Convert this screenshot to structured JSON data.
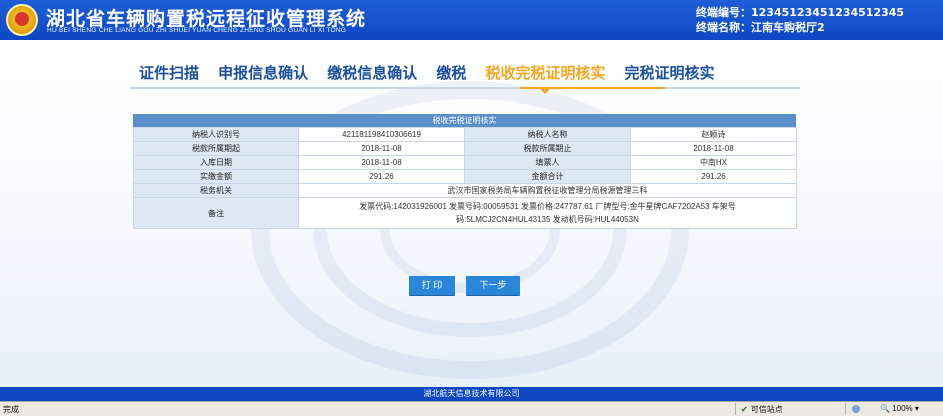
{
  "header": {
    "title_cn": "湖北省车辆购置税远程征收管理系统",
    "title_en": "HU BEI SHENG CHE LIANG GOU ZHI SHUEI YUAN CHENG ZHENG SHOU GUAN LI XI TONG",
    "terminal_no": "终端编号：12345123451234512345",
    "terminal_name": "终端名称：江南车购税厅2"
  },
  "steps": [
    {
      "label": "证件扫描",
      "active": false
    },
    {
      "label": "申报信息确认",
      "active": false
    },
    {
      "label": "缴税信息确认",
      "active": false
    },
    {
      "label": "缴税",
      "active": false
    },
    {
      "label": "税收完税证明核实",
      "active": true
    },
    {
      "label": "完税证明核实",
      "active": false
    }
  ],
  "panel": {
    "title": "税收完税证明核实",
    "rows": [
      [
        "纳税人识别号",
        "421181198410306619",
        "纳税人名称",
        "赵颖诗"
      ],
      [
        "税款所属期起",
        "2018-11-08",
        "税款所属期止",
        "2018-11-08"
      ],
      [
        "入库日期",
        "2018-11-08",
        "填票人",
        "中南HX"
      ],
      [
        "实缴金额",
        "291.26",
        "金额合计",
        "291.26"
      ]
    ],
    "tax_office_label": "税务机关",
    "tax_office_value": "武汉市国家税务局车辆购置税征收管理分局税源管理三科",
    "remark_label": "备注",
    "remark_line1": "发票代码:142031926001 发票号码:00059531 发票价格:247787.61 厂牌型号:金牛星牌CAF7202A53 车架号",
    "remark_line2": "码:5LMCJ2CN4HUL43135 发动机号码:HUL44053N"
  },
  "buttons": {
    "print": "打 印",
    "next": "下一步"
  },
  "footer": "湖北航天信息技术有限公司",
  "statusbar": {
    "left": "完成",
    "site": "可信站点",
    "zoom": "100%"
  },
  "colors": {
    "header_blue": "#0d47c2",
    "step_blue": "#1c4f9c",
    "step_active": "#f5a623",
    "button_blue": "#2a86d8"
  }
}
